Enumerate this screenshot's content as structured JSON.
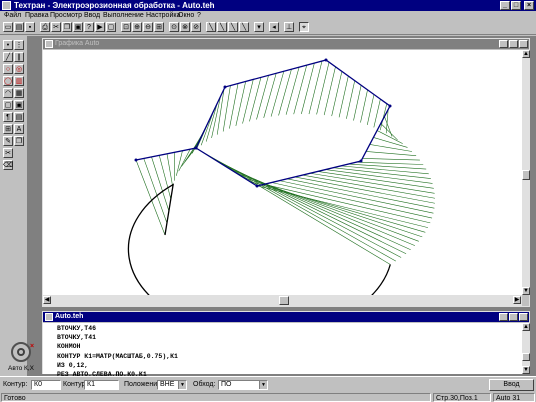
{
  "app": {
    "title": "Техтран - Электроэрозионная обработка - Auto.teh",
    "window_buttons": [
      "_",
      "□",
      "×"
    ]
  },
  "menu": {
    "items": [
      "Файл",
      "Правка",
      "Просмотр",
      "Ввод",
      "Выполнение",
      "Настройка",
      "Окно",
      "?"
    ]
  },
  "toolbar": {
    "icons": [
      "new-file-icon",
      "open-file-icon",
      "save-icon",
      "print-icon",
      "cut-icon",
      "copy-icon",
      "paste-icon",
      "help-icon",
      "run-icon",
      "window-icon",
      "zoom-window-icon",
      "zoom-in-icon",
      "zoom-out-icon",
      "zoom-extents-icon",
      "zoom-previous-icon",
      "zoom-all-icon",
      "zoom-real-icon",
      "line-tool-icon",
      "line-tool-2-icon",
      "line-tool-3-icon",
      "line-tool-4-icon",
      "point-icon",
      "measure-icon",
      "dimension-icon",
      "axes-icon"
    ]
  },
  "palette": {
    "icons": [
      "point-tool-icon",
      "grid-tool-icon",
      "line-tool-icon",
      "parallel-tool-icon",
      "circle-tool-icon",
      "circle-fill-icon",
      "contour-tool-icon",
      "box-tool-icon",
      "arc-tool-icon",
      "table-tool-icon",
      "shape-tool-icon",
      "region-tool-icon",
      "text-tool-icon",
      "group-tool-icon",
      "array-tool-icon",
      "letter-a-icon",
      "edit-tool-icon",
      "copy-tool-icon",
      "cut-tool-icon",
      "delete-tool-icon"
    ]
  },
  "graph_window": {
    "title": "Графика Auto"
  },
  "text_window": {
    "title": "Auto.teh",
    "lines": [
      "ВТОЧКУ,Т46",
      "ВТОЧКУ,Т41",
      "КОНМОН",
      "КОНТУР К1=МАТР(МАСШТАБ,0.75),К1",
      "ИЗ 0,12,",
      "РЕЗ АВТО,СЛЕВА,ПО,К0,К1"
    ]
  },
  "auto_badge": {
    "label": "Авто К,Х"
  },
  "input_bar": {
    "contour_label": "Контур:",
    "contour_value": "К0",
    "contour2_label": "Контур:",
    "contour2_value": "К1",
    "position_label": "Положение:",
    "position_value": "ВНЕ",
    "bypass_label": "Обход:",
    "bypass_value": "ПО",
    "enter_button": "Ввод"
  },
  "status_bar": {
    "left": "Готово",
    "position": "Стр.30,Поз.1",
    "mode": "Auto 31"
  },
  "colors": {
    "titlebar_active": "#000080",
    "titlebar_inactive": "#808080",
    "face": "#c0c0c0",
    "contour_line": "#000080",
    "ruled_lines": "#1f6f1f"
  }
}
